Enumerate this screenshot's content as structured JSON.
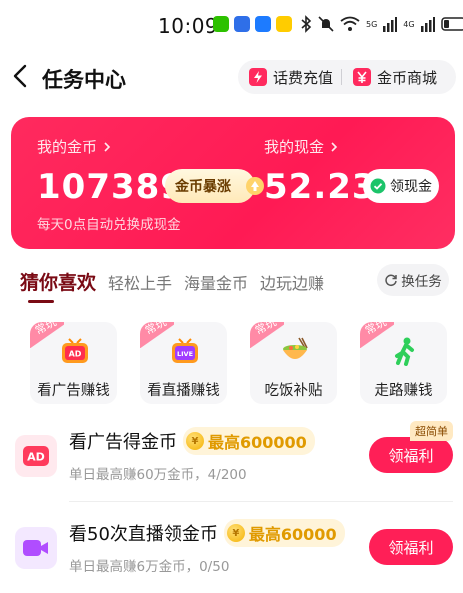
{
  "status_bar": {
    "time": "10:09",
    "network": [
      "5G",
      "4G"
    ]
  },
  "header": {
    "title": "任务中心",
    "recharge_label": "话费充值",
    "mall_label": "金币商城"
  },
  "banner": {
    "coins_label": "我的金币",
    "coins_value": "107389",
    "boost_label": "金币暴涨",
    "cash_label": "我的现金",
    "cash_value": "52.23",
    "withdraw_label": "领现金",
    "note": "每天0点自动兑换成现金",
    "colors": {
      "bg": "#ff1f57"
    }
  },
  "tabs": {
    "items": [
      "猜你喜欢",
      "轻松上手",
      "海量金币",
      "边玩边赚"
    ],
    "active_index": 0,
    "switch_label": "换任务"
  },
  "categories": [
    {
      "tag": "常玩",
      "label": "看广告赚钱",
      "icon": "tv-ad-icon"
    },
    {
      "tag": "常玩",
      "label": "看直播赚钱",
      "icon": "tv-live-icon"
    },
    {
      "tag": "常玩",
      "label": "吃饭补贴",
      "icon": "food-bowl-icon"
    },
    {
      "tag": "常玩",
      "label": "走路赚钱",
      "icon": "walking-person-icon"
    }
  ],
  "tasks": [
    {
      "title": "看广告得金币",
      "reward": "最高600000",
      "subtitle": "单日最高赚60万金币，4/200",
      "button": "领福利",
      "tag": "超简单",
      "icon": "ad-icon"
    },
    {
      "title": "看50次直播领金币",
      "reward": "最高60000",
      "subtitle": "单日最高赚6万金币，0/50",
      "button": "领福利",
      "icon": "video-camera-icon"
    }
  ]
}
